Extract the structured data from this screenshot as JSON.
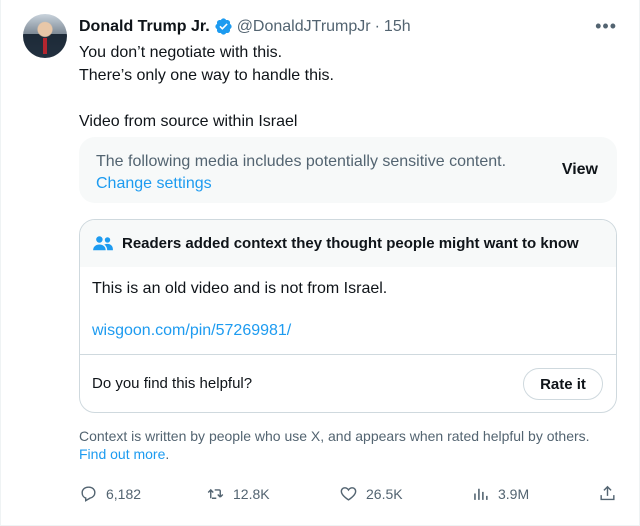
{
  "tweet": {
    "author_name": "Donald Trump Jr.",
    "author_handle": "@DonaldJTrumpJr",
    "separator": "·",
    "time": "15h",
    "more_label": "•••",
    "text_lines": [
      "You don’t negotiate with this.",
      "There’s only one way to handle this.",
      "",
      "Video from source within Israel"
    ]
  },
  "sensitive_media": {
    "notice": "The following media includes potentially sensitive content.",
    "settings_link": "Change settings",
    "view_label": "View"
  },
  "community_note": {
    "title": "Readers added context they thought people might want to know",
    "body": "This is an old video and is not from Israel.",
    "link": "wisgoon.com/pin/57269981/",
    "helpful_prompt": "Do you find this helpful?",
    "rate_label": "Rate it"
  },
  "context_footer": {
    "text": "Context is written by people who use X, and appears when rated helpful by others.",
    "link": "Find out more",
    "period": "."
  },
  "actions": {
    "replies": "6,182",
    "reposts": "12.8K",
    "likes": "26.5K",
    "views": "3.9M"
  },
  "colors": {
    "accent": "#1d9bf0",
    "secondary_text": "#536471",
    "primary_text": "#0f1419"
  }
}
